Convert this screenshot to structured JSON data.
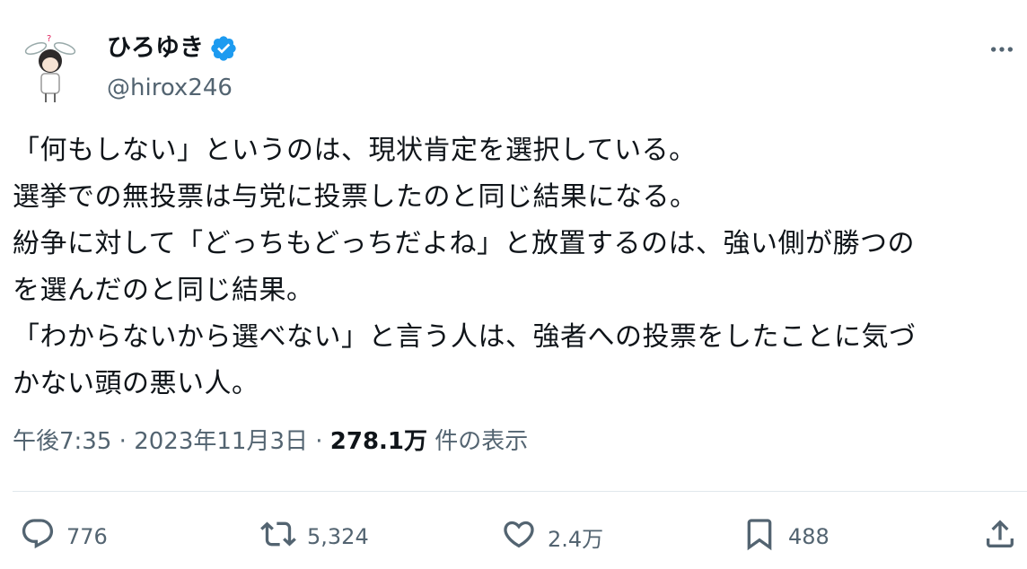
{
  "user": {
    "display_name": "ひろゆき",
    "handle": "@hirox246",
    "verified_icon": "verified-badge-icon",
    "verified_color": "#1d9bf0"
  },
  "tweet": {
    "lines": [
      "「何もしない」というのは、現状肯定を選択している。",
      "選挙での無投票は与党に投票したのと同じ結果になる。",
      "紛争に対して「どっちもどっちだよね」と放置するのは、強い側が勝つの",
      "を選んだのと同じ結果。",
      "「わからないから選べない」と言う人は、強者への投票をしたことに気づ",
      "かない頭の悪い人。"
    ]
  },
  "meta": {
    "time": "午後7:35",
    "separator1": " · ",
    "date": "2023年11月3日",
    "separator2": " · ",
    "views": "278.1万",
    "views_label": " 件の表示"
  },
  "actions": {
    "reply": {
      "icon": "reply-icon",
      "count": "776"
    },
    "retweet": {
      "icon": "retweet-icon",
      "count": "5,324"
    },
    "like": {
      "icon": "heart-icon",
      "count": "2.4万"
    },
    "bookmark": {
      "icon": "bookmark-icon",
      "count": "488"
    },
    "share": {
      "icon": "share-icon"
    }
  },
  "more_icon": "more-options-icon"
}
